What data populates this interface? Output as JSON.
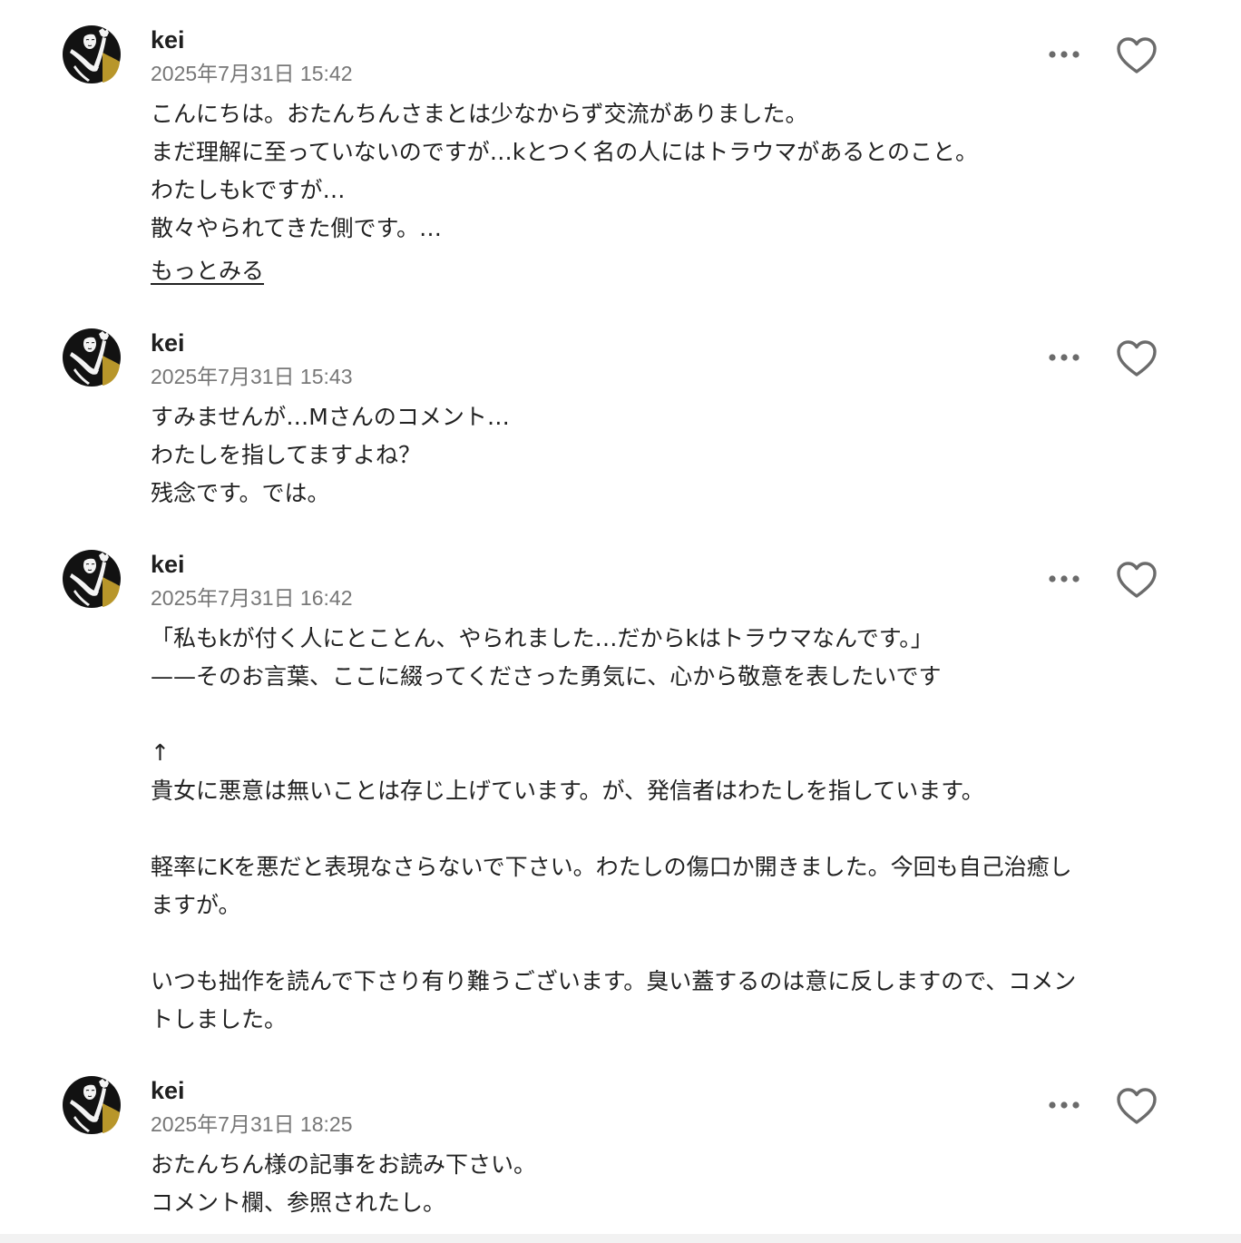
{
  "comments": [
    {
      "author": "kei",
      "timestamp": "2025年7月31日 15:42",
      "lines": [
        "こんにちは。おたんちんさまとは少なからず交流がありました。",
        "まだ理解に至っていないのですが…kとつく名の人にはトラウマがあるとのこと。",
        "わたしもkですが…",
        "散々やられてきた側です。…"
      ],
      "more_label": "もっとみる"
    },
    {
      "author": "kei",
      "timestamp": "2025年7月31日 15:43",
      "lines": [
        "すみませんが…Mさんのコメント…",
        "わたしを指してますよね？",
        "残念です。では。"
      ]
    },
    {
      "author": "kei",
      "timestamp": "2025年7月31日 16:42",
      "lines": [
        "「私もkが付く人にとことん、やられました…だからkはトラウマなんです。」",
        "——そのお言葉、ここに綴ってくださった勇気に、心から敬意を表したいです",
        "",
        "↑",
        "貴女に悪意は無いことは存じ上げています。が、発信者はわたしを指しています。",
        "",
        "軽率にKを悪だと表現なさらないで下さい。わたしの傷口か開きました。今回も自己治癒し",
        "ますが。",
        "",
        "いつも拙作を読んで下さり有り難うございます。臭い蓋するのは意に反しますので、コメン",
        "トしました。"
      ]
    },
    {
      "author": "kei",
      "timestamp": "2025年7月31日 18:25",
      "lines": [
        "おたんちん様の記事をお読み下さい。",
        "コメント欄、参照されたし。"
      ]
    }
  ],
  "icons": {
    "more": "more-horizontal-icon",
    "like": "heart-outline-icon",
    "avatar": "user-avatar-illustration"
  },
  "colors": {
    "text": "#222222",
    "timestamp": "#777777",
    "icon": "#6b6b6b",
    "avatar_gold": "#b8962a"
  }
}
